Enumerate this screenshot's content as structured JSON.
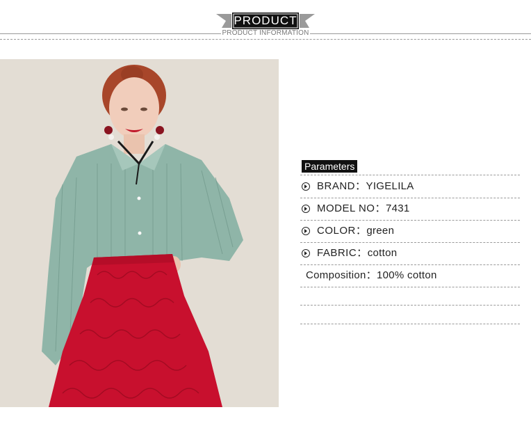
{
  "header": {
    "title": "PRODUCT",
    "subtitle": "PRODUCT INFORMATION"
  },
  "parameters": {
    "heading": "Parameters",
    "rows": [
      {
        "label": "BRAND：",
        "value": "YIGELILA"
      },
      {
        "label": "MODEL NO：",
        "value": "7431"
      },
      {
        "label": "COLOR：",
        "value": "green"
      },
      {
        "label": "FABRIC：",
        "value": "cotton"
      }
    ],
    "composition": {
      "label": "Composition：",
      "value": "100% cotton"
    }
  },
  "colors": {
    "banner": "#111111",
    "banner_wings": "#9a9a9a",
    "shirt": "#8fb5a8",
    "skirt": "#c8102e",
    "background_photo": "#e3ddd4"
  }
}
